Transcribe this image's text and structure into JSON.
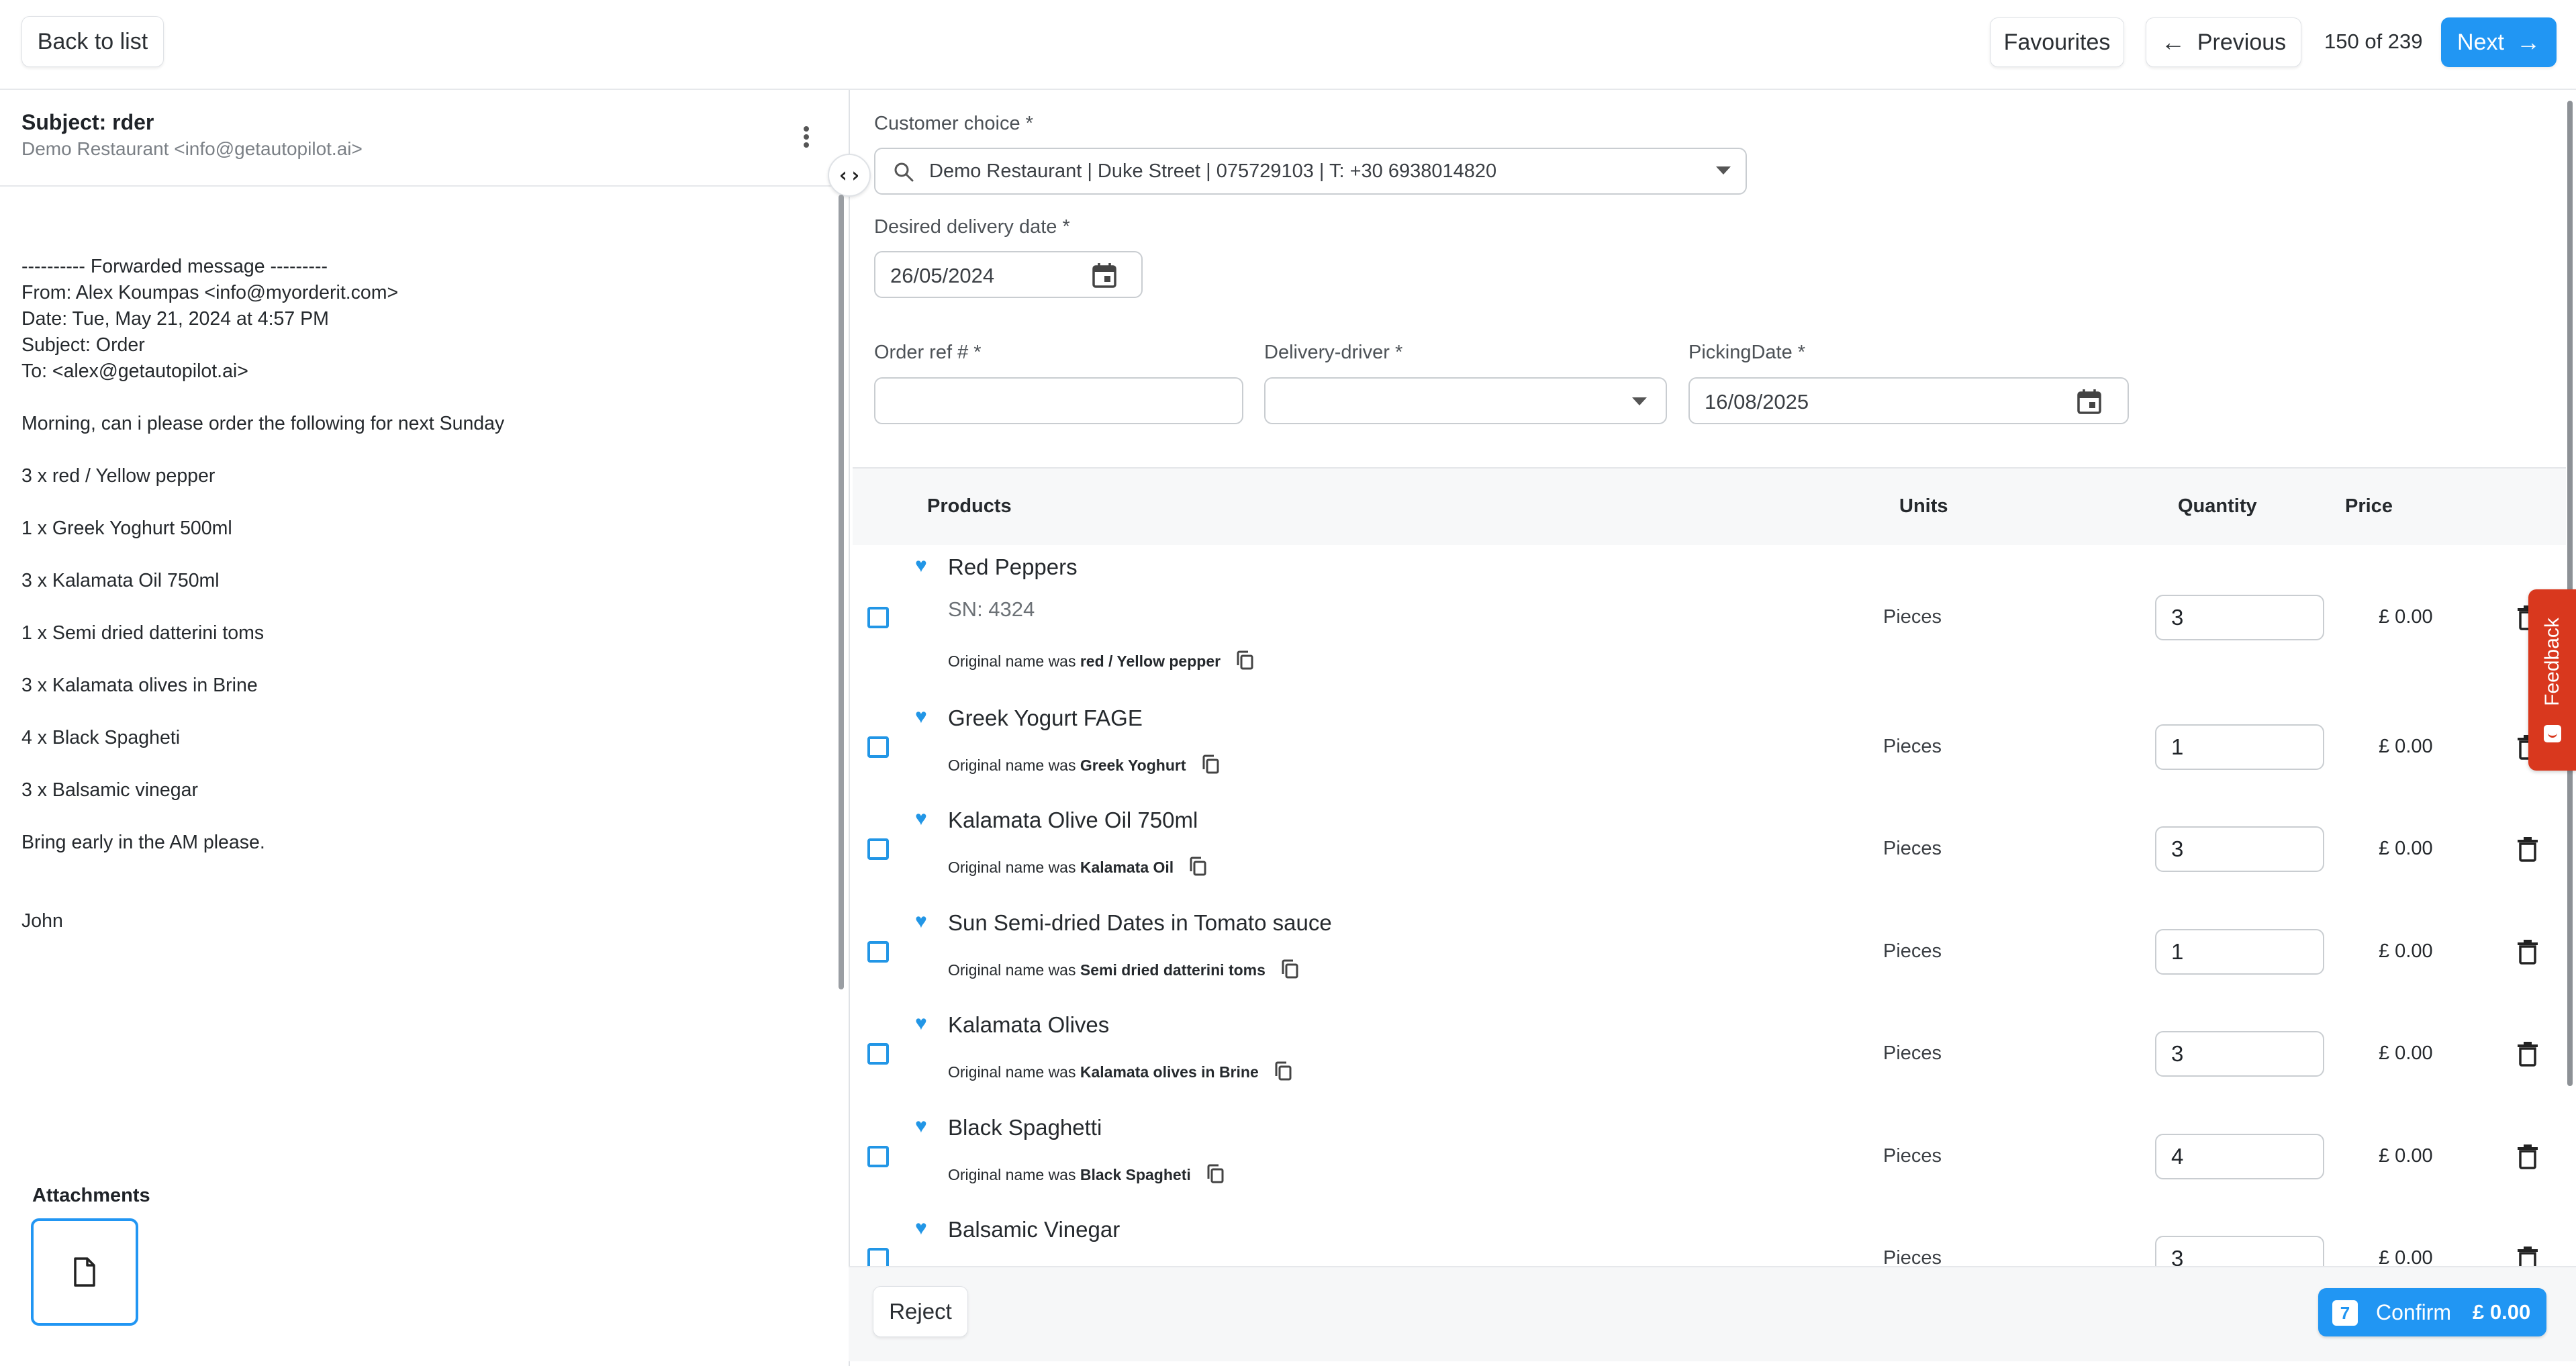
{
  "topbar": {
    "back_label": "Back to list",
    "favourites_label": "Favourites",
    "previous_label": "Previous",
    "pager_text": "150 of 239",
    "next_label": "Next"
  },
  "email": {
    "subject": "Subject: rder",
    "sender": "Demo Restaurant <info@getautopilot.ai>",
    "body_lines": [
      "---------- Forwarded message ---------",
      "From: Alex Koumpas <info@myorderit.com>",
      "Date: Tue, May 21, 2024 at 4:57 PM",
      "Subject: Order",
      "To: <alex@getautopilot.ai>",
      "",
      "Morning, can i please order the following for next Sunday",
      "",
      "3 x red / Yellow pepper",
      "",
      "1 x Greek Yoghurt 500ml",
      "",
      "3 x Kalamata Oil 750ml",
      "",
      "1 x Semi dried datterini toms",
      "",
      "3 x Kalamata olives in Brine",
      "",
      "4 x Black Spagheti",
      "",
      "3 x Balsamic vinegar",
      "",
      "Bring early in the AM please.",
      "",
      "",
      "John"
    ],
    "attachments_label": "Attachments"
  },
  "form": {
    "customer_label": "Customer choice *",
    "customer_value": "Demo Restaurant | Duke Street | 075729103 | T: +30 6938014820",
    "delivery_date_label": "Desired delivery date *",
    "delivery_date_value": "26/05/2024",
    "order_ref_label": "Order ref # *",
    "order_ref_value": "",
    "driver_label": "Delivery-driver *",
    "driver_value": "",
    "picking_label": "PickingDate *",
    "picking_value": "16/08/2025"
  },
  "table": {
    "headers": {
      "products": "Products",
      "units": "Units",
      "quantity": "Quantity",
      "price": "Price"
    },
    "orig_prefix": "Original name was",
    "rows": [
      {
        "name": "Red Peppers",
        "sn": "SN: 4324",
        "original": "red / Yellow pepper",
        "units": "Pieces",
        "qty": "3",
        "price": "£ 0.00"
      },
      {
        "name": "Greek Yogurt FAGE",
        "sn": "",
        "original": "Greek Yoghurt",
        "units": "Pieces",
        "qty": "1",
        "price": "£ 0.00"
      },
      {
        "name": "Kalamata Olive Oil 750ml",
        "sn": "",
        "original": "Kalamata Oil",
        "units": "Pieces",
        "qty": "3",
        "price": "£ 0.00"
      },
      {
        "name": "Sun Semi-dried Dates in Tomato sauce",
        "sn": "",
        "original": "Semi dried datterini toms",
        "units": "Pieces",
        "qty": "1",
        "price": "£ 0.00"
      },
      {
        "name": "Kalamata Olives",
        "sn": "",
        "original": "Kalamata olives in Brine",
        "units": "Pieces",
        "qty": "3",
        "price": "£ 0.00"
      },
      {
        "name": "Black Spaghetti",
        "sn": "",
        "original": "Black Spagheti",
        "units": "Pieces",
        "qty": "4",
        "price": "£ 0.00"
      },
      {
        "name": "Balsamic Vinegar",
        "sn": "",
        "original": "",
        "units": "Pieces",
        "qty": "3",
        "price": "£ 0.00"
      }
    ]
  },
  "footer": {
    "reject_label": "Reject",
    "confirm_count": "7",
    "confirm_label": "Confirm",
    "confirm_total": "£ 0.00"
  },
  "feedback_label": "Feedback",
  "colors": {
    "accent": "#2196f3",
    "feedback": "#d9381e"
  }
}
